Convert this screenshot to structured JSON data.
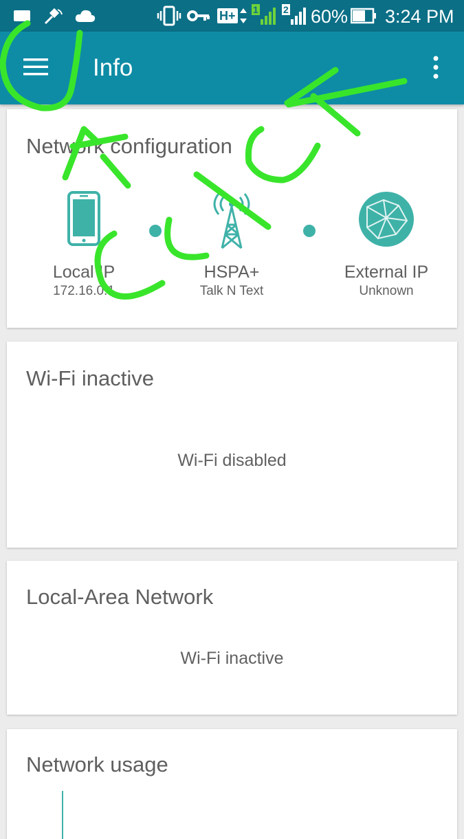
{
  "status_bar": {
    "battery": "60%",
    "time": "3:24 PM",
    "network_type": "H+",
    "sim1": "1",
    "sim2": "2",
    "icons": [
      "notification-icon",
      "satellite-icon",
      "cloud-icon",
      "vibrate-icon",
      "vpn-key-icon",
      "hplus-data-icon",
      "sim1-signal-icon",
      "sim2-signal-icon",
      "battery-icon"
    ]
  },
  "app_bar": {
    "title": "Info",
    "menu_icon": "hamburger-menu-icon",
    "overflow_icon": "more-vert-icon",
    "color": "#0e8ca5"
  },
  "network_config": {
    "title": "Network configuration",
    "local": {
      "label": "Local IP",
      "value": "172.16.0.1",
      "icon": "phone-icon"
    },
    "carrier": {
      "label": "HSPA+",
      "value": "Talk N Text",
      "icon": "cell-tower-icon"
    },
    "external": {
      "label": "External IP",
      "value": "Unknown",
      "icon": "globe-icon"
    },
    "accent": "#3fb2a8"
  },
  "wifi_card": {
    "title": "Wi-Fi inactive",
    "message": "Wi-Fi disabled"
  },
  "lan_card": {
    "title": "Local-Area Network",
    "message": "Wi-Fi inactive"
  },
  "usage_card": {
    "title": "Network usage"
  },
  "annotation": {
    "text": "CLICK",
    "color": "#39e52b"
  }
}
